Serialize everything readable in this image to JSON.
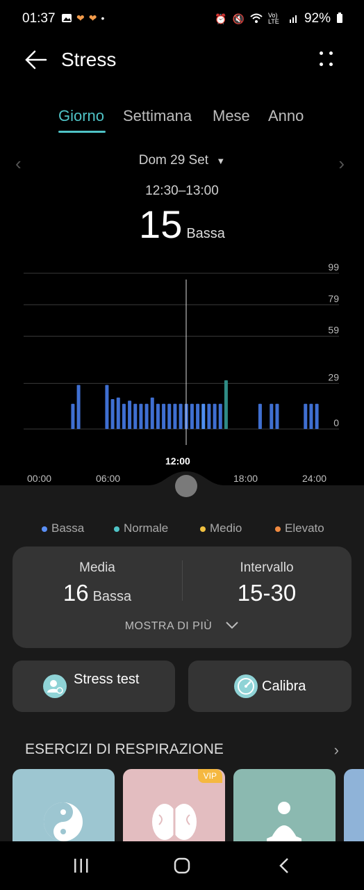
{
  "status_bar": {
    "time": "01:37",
    "battery": "92%",
    "network": "Vo) LTE"
  },
  "header": {
    "title": "Stress"
  },
  "tabs": [
    {
      "label": "Giorno",
      "active": true
    },
    {
      "label": "Settimana",
      "active": false
    },
    {
      "label": "Mese",
      "active": false
    },
    {
      "label": "Anno",
      "active": false
    }
  ],
  "date": {
    "label": "Dom 29 Set"
  },
  "selected": {
    "range": "12:30–13:00",
    "value": "15",
    "level": "Bassa"
  },
  "chart_data": {
    "type": "bar",
    "y_ticks": [
      "99",
      "79",
      "59",
      "29",
      "0"
    ],
    "x_ticks": [
      "00:00",
      "06:00",
      "12:00",
      "18:00",
      "24:00"
    ],
    "highlight_x": "12:00",
    "ylim": [
      0,
      99
    ],
    "bars": [
      {
        "t": 2.75,
        "v": 16,
        "c": "#3f6fd1"
      },
      {
        "t": 3.25,
        "v": 28,
        "c": "#3f6fd1"
      },
      {
        "t": 5.75,
        "v": 28,
        "c": "#3f6fd1"
      },
      {
        "t": 6.25,
        "v": 19,
        "c": "#3f6fd1"
      },
      {
        "t": 6.75,
        "v": 20,
        "c": "#3f6fd1"
      },
      {
        "t": 7.25,
        "v": 16,
        "c": "#3f6fd1"
      },
      {
        "t": 7.75,
        "v": 18,
        "c": "#3f6fd1"
      },
      {
        "t": 8.25,
        "v": 16,
        "c": "#3f6fd1"
      },
      {
        "t": 8.75,
        "v": 16,
        "c": "#3f6fd1"
      },
      {
        "t": 9.25,
        "v": 16,
        "c": "#3f6fd1"
      },
      {
        "t": 9.75,
        "v": 20,
        "c": "#3f6fd1"
      },
      {
        "t": 10.25,
        "v": 16,
        "c": "#3f6fd1"
      },
      {
        "t": 10.75,
        "v": 16,
        "c": "#3f6fd1"
      },
      {
        "t": 11.25,
        "v": 16,
        "c": "#3f6fd1"
      },
      {
        "t": 11.75,
        "v": 16,
        "c": "#3f6fd1"
      },
      {
        "t": 12.25,
        "v": 16,
        "c": "#3f6fd1"
      },
      {
        "t": 12.75,
        "v": 16,
        "c": "#3f6fd1"
      },
      {
        "t": 13.25,
        "v": 16,
        "c": "#3f6fd1"
      },
      {
        "t": 13.75,
        "v": 16,
        "c": "#3f6fd1"
      },
      {
        "t": 14.25,
        "v": 16,
        "c": "#4f8ff0"
      },
      {
        "t": 14.75,
        "v": 16,
        "c": "#3f6fd1"
      },
      {
        "t": 15.25,
        "v": 16,
        "c": "#3f6fd1"
      },
      {
        "t": 15.75,
        "v": 16,
        "c": "#3f6fd1"
      },
      {
        "t": 16.25,
        "v": 31,
        "c": "#2f8b85"
      },
      {
        "t": 19.25,
        "v": 16,
        "c": "#3f6fd1"
      },
      {
        "t": 20.25,
        "v": 16,
        "c": "#3f6fd1"
      },
      {
        "t": 20.75,
        "v": 16,
        "c": "#3f6fd1"
      },
      {
        "t": 23.25,
        "v": 16,
        "c": "#3f6fd1"
      },
      {
        "t": 23.75,
        "v": 16,
        "c": "#3f6fd1"
      },
      {
        "t": 24.25,
        "v": 16,
        "c": "#3f6fd1"
      }
    ]
  },
  "legend": [
    {
      "label": "Bassa",
      "color": "#5a8ff5"
    },
    {
      "label": "Normale",
      "color": "#4fc3c6"
    },
    {
      "label": "Medio",
      "color": "#f0c040"
    },
    {
      "label": "Elevato",
      "color": "#f08a40"
    }
  ],
  "summary": {
    "media_label": "Media",
    "media_value": "16",
    "media_level": "Bassa",
    "interval_label": "Intervallo",
    "interval_value": "15-30",
    "show_more": "MOSTRA DI PIÙ"
  },
  "actions": {
    "stress_test": "Stress test",
    "calibrate": "Calibra"
  },
  "breathing": {
    "title": "ESERCIZI DI RESPIRAZIONE",
    "tiles": [
      {
        "icon": "yin-yang-fish-icon",
        "color": "#9dc6d1"
      },
      {
        "icon": "brain-icon",
        "color": "#e3bdc0",
        "badge": "VIP"
      },
      {
        "icon": "meditation-icon",
        "color": "#8bb9b0"
      },
      {
        "icon": "tile-icon",
        "color": "#8fb3d8"
      }
    ]
  }
}
